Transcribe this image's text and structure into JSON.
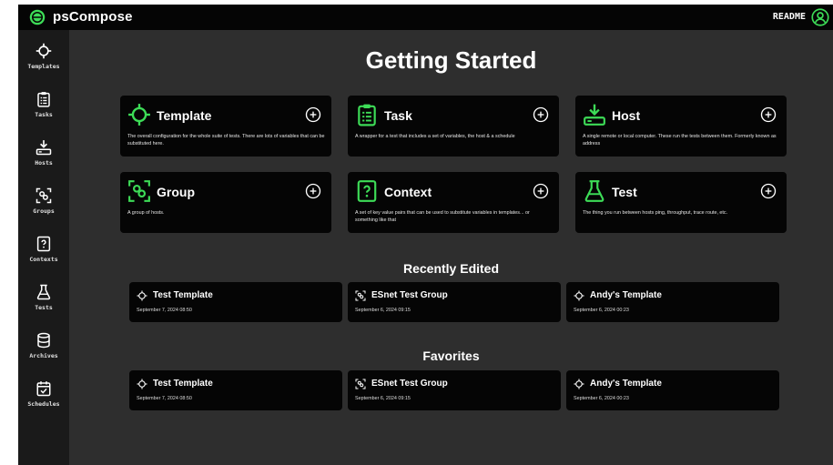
{
  "app": {
    "title": "psCompose",
    "readme_label": "README"
  },
  "colors": {
    "accent": "#3ddc57",
    "background": "#2e2e2e",
    "card": "#050505",
    "sidebar": "#1a1a1a"
  },
  "sidebar": {
    "items": [
      {
        "label": "Templates",
        "icon": "crosshair-icon"
      },
      {
        "label": "Tasks",
        "icon": "clipboard-icon"
      },
      {
        "label": "Hosts",
        "icon": "host-download-icon"
      },
      {
        "label": "Groups",
        "icon": "group-icon"
      },
      {
        "label": "Contexts",
        "icon": "context-icon"
      },
      {
        "label": "Tests",
        "icon": "flask-icon"
      },
      {
        "label": "Archives",
        "icon": "database-icon"
      },
      {
        "label": "Schedules",
        "icon": "calendar-icon"
      }
    ]
  },
  "main": {
    "title": "Getting Started",
    "cards": [
      {
        "title": "Template",
        "icon": "crosshair-icon",
        "description": "The overall configuration for the whole suite of tests. There are lots of variables that can be substituted here."
      },
      {
        "title": "Task",
        "icon": "clipboard-icon",
        "description": "A wrapper for a test that includes a set of variables, the host & a schedule"
      },
      {
        "title": "Host",
        "icon": "host-download-icon",
        "description": "A single remote or local computer.  These run the tests between them. Formerly known as address"
      },
      {
        "title": "Group",
        "icon": "group-icon",
        "description": "A group of hosts."
      },
      {
        "title": "Context",
        "icon": "context-icon",
        "description": "A set of key value pairs that can be used to substitute variables in templates... or something like that"
      },
      {
        "title": "Test",
        "icon": "flask-icon",
        "description": "The thing you run between hosts ping, throughput, trace route, etc."
      }
    ],
    "recently_edited": {
      "title": "Recently Edited",
      "items": [
        {
          "name": "Test Template",
          "date": "September 7, 2024 08:50",
          "icon": "crosshair-icon"
        },
        {
          "name": "ESnet Test Group",
          "date": "September 6, 2024 09:15",
          "icon": "group-icon"
        },
        {
          "name": "Andy's Template",
          "date": "September 6, 2024 00:23",
          "icon": "crosshair-icon"
        }
      ]
    },
    "favorites": {
      "title": "Favorites",
      "items": [
        {
          "name": "Test Template",
          "date": "September 7, 2024 08:50",
          "icon": "crosshair-icon"
        },
        {
          "name": "ESnet Test Group",
          "date": "September 6, 2024 09:15",
          "icon": "group-icon"
        },
        {
          "name": "Andy's Template",
          "date": "September 6, 2024 00:23",
          "icon": "crosshair-icon"
        }
      ]
    }
  }
}
